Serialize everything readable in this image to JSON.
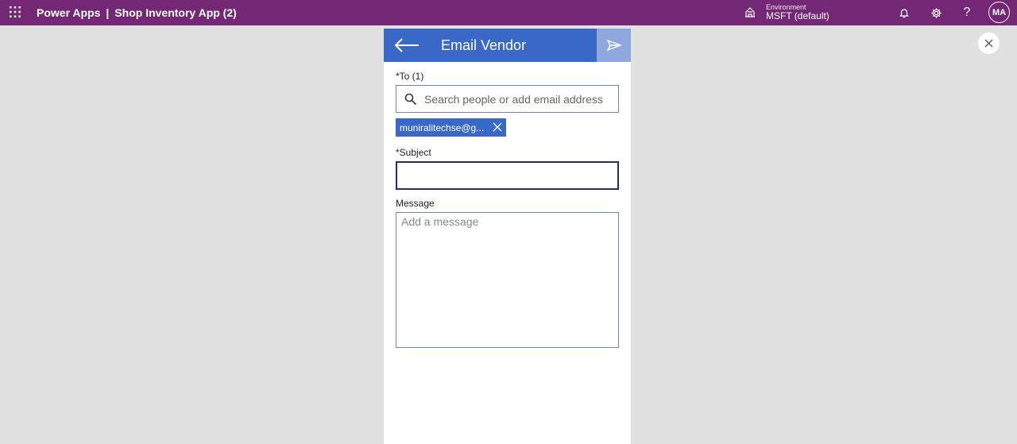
{
  "topbar": {
    "app_name": "Power Apps",
    "separator": "|",
    "app_title": "Shop Inventory App (2)",
    "environment_label": "Environment",
    "environment_name": "MSFT (default)",
    "help_glyph": "?",
    "avatar_initials": "MA",
    "icons": [
      "waffle-icon",
      "environment-icon",
      "bell-icon",
      "gear-icon",
      "help-icon"
    ]
  },
  "screen": {
    "title": "Email Vendor",
    "header_color": "#3a68c7",
    "send_button_color": "#8ea8dd",
    "to_label": "*To (1)",
    "search_placeholder": "Search people or add email address",
    "recipients": [
      "muniralitechse@g..."
    ],
    "subject_label": "*Subject",
    "subject_value": "",
    "message_label": "Message",
    "message_placeholder": "Add a message"
  },
  "colors": {
    "topbar": "#742774",
    "background": "#e1e1e1"
  }
}
